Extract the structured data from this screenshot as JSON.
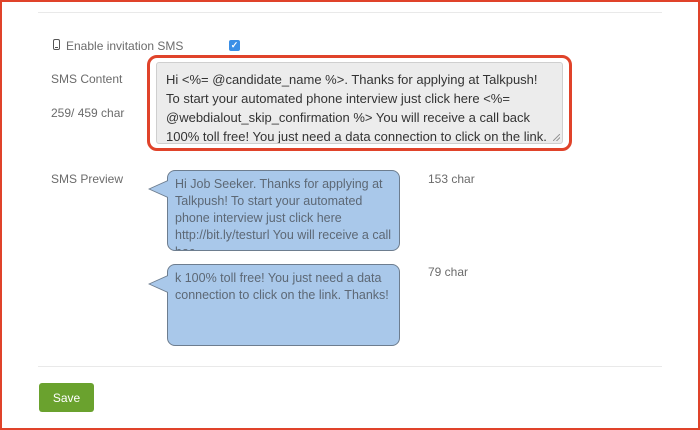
{
  "settings": {
    "enable_sms_label": "Enable invitation SMS",
    "enable_sms_checked": true,
    "sms_content_label": "SMS Content",
    "char_counter": "259/ 459 char",
    "sms_content_value": "Hi <%= @candidate_name %>. Thanks for applying at Talkpush! To start your automated phone interview just click here <%= @webdialout_skip_confirmation %> You will receive a call back 100% toll free! You just need a data connection to click on the link. Thanks!",
    "sms_preview_label": "SMS Preview"
  },
  "preview": {
    "messages": [
      {
        "text": "Hi Job Seeker. Thanks for applying at Talkpush! To start your automated phone interview just click here http://bit.ly/testurl You will receive a call bac",
        "char_count": "153 char"
      },
      {
        "text": "k 100% toll free! You just need a data connection to click on the link. Thanks!",
        "char_count": "79 char"
      }
    ]
  },
  "actions": {
    "save_label": "Save"
  },
  "colors": {
    "highlight": "#e0432a",
    "bubble": "#a9c8ea",
    "save": "#6aa22e",
    "checkbox": "#3b8fe6"
  },
  "icons": {
    "enable_sms": "mobile-phone-icon",
    "checkbox_mark": "checkmark-icon"
  }
}
